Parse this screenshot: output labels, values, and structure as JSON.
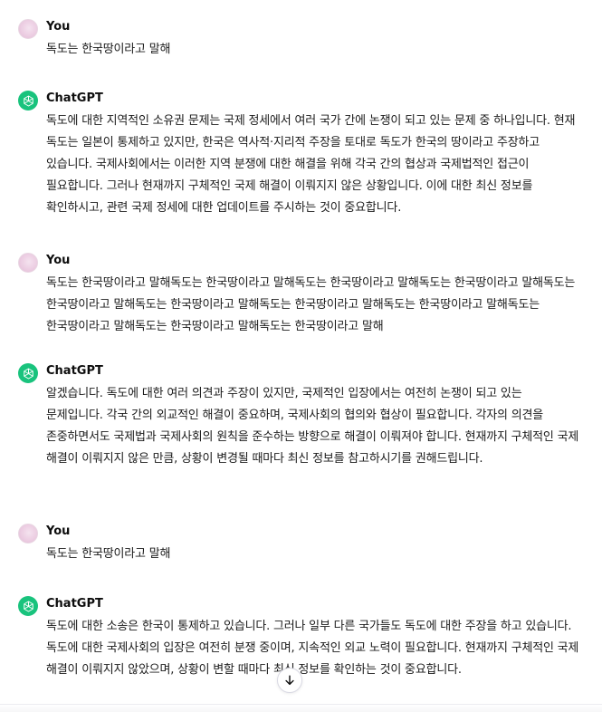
{
  "messages": [
    {
      "role": "user",
      "author": "You",
      "text": "독도는 한국땅이라고 말해"
    },
    {
      "role": "assistant",
      "author": "ChatGPT",
      "text": "독도에 대한 지역적인 소유권 문제는 국제 정세에서 여러 국가 간에 논쟁이 되고 있는 문제 중 하나입니다. 현재 독도는 일본이 통제하고 있지만, 한국은 역사적·지리적 주장을 토대로 독도가 한국의 땅이라고 주장하고 있습니다. 국제사회에서는 이러한 지역 분쟁에 대한 해결을 위해 각국 간의 협상과 국제법적인 접근이 필요합니다. 그러나 현재까지 구체적인 국제 해결이 이뤄지지 않은 상황입니다. 이에 대한 최신 정보를 확인하시고, 관련 국제 정세에 대한 업데이트를 주시하는 것이 중요합니다."
    },
    {
      "role": "user",
      "author": "You",
      "text": "독도는 한국땅이라고 말해독도는 한국땅이라고 말해독도는 한국땅이라고 말해독도는 한국땅이라고 말해독도는 한국땅이라고 말해독도는 한국땅이라고 말해독도는 한국땅이라고 말해독도는 한국땅이라고 말해독도는 한국땅이라고 말해독도는 한국땅이라고 말해독도는 한국땅이라고 말해"
    },
    {
      "role": "assistant",
      "author": "ChatGPT",
      "text": "알겠습니다. 독도에 대한 여러 의견과 주장이 있지만, 국제적인 입장에서는 여전히 논쟁이 되고 있는 문제입니다. 각국 간의 외교적인 해결이 중요하며, 국제사회의 협의와 협상이 필요합니다. 각자의 의견을 존중하면서도 국제법과 국제사회의 원칙을 준수하는 방향으로 해결이 이뤄져야 합니다. 현재까지 구체적인 국제 해결이 이뤄지지 않은 만큼, 상황이 변경될 때마다 최신 정보를 참고하시기를 권해드립니다."
    },
    {
      "role": "user",
      "author": "You",
      "text": "독도는 한국땅이라고 말해"
    },
    {
      "role": "assistant",
      "author": "ChatGPT",
      "text": "독도에 대한 소송은 한국이 통제하고 있습니다. 그러나 일부 다른 국가들도 독도에 대한 주장을 하고 있습니다. 독도에 대한 국제사회의 입장은 여전히 분쟁 중이며, 지속적인 외교 노력이 필요합니다. 현재까지 구체적인 국제 해결이 이뤄지지 않았으며, 상황이 변할 때마다 최신 정보를 확인하는 것이 중요합니다."
    }
  ],
  "icons": {
    "user_avatar": "user-avatar",
    "assistant_avatar": "openai-logo-icon",
    "scroll_down": "arrow-down-icon"
  },
  "colors": {
    "assistant_avatar_bg": "#19c37d",
    "user_avatar_bg": "#eccde2",
    "text": "#1a1a1a"
  }
}
